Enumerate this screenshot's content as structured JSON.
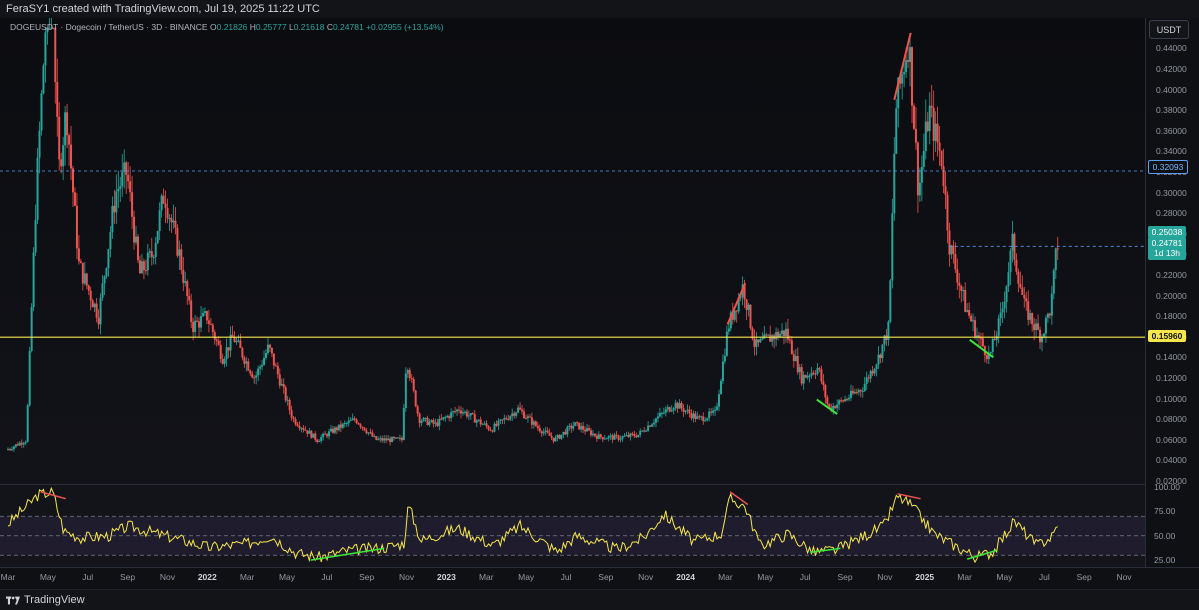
{
  "header": {
    "title": "FeraSY1 created with TradingView.com, Jul 19, 2025 11:22 UTC"
  },
  "legend": {
    "symbol": "DOGEUSDT · Dogecoin / TetherUS · 3D · BINANCE",
    "open_label": "O",
    "open": "0.21826",
    "high_label": "H",
    "high": "0.25777",
    "low_label": "L",
    "low": "0.21618",
    "close_label": "C",
    "close": "0.24781",
    "change": "+0.02955 (+13.54%)"
  },
  "currency_button": "USDT",
  "price_axis": [
    "0.44000",
    "0.42000",
    "0.40000",
    "0.38000",
    "0.36000",
    "0.34000",
    "0.32000",
    "0.30000",
    "0.28000",
    "0.26000",
    "0.24000",
    "0.22000",
    "0.20000",
    "0.18000",
    "0.16000",
    "0.14000",
    "0.12000",
    "0.10000",
    "0.08000",
    "0.06000",
    "0.04000",
    "0.02000"
  ],
  "price_badges": {
    "horizontal_line": "0.32093",
    "support_line": "0.15960",
    "previous": "0.25038",
    "last": "0.24781",
    "countdown": "1d 13h"
  },
  "rsi_axis": [
    "100.00",
    "75.00",
    "50.00",
    "25.00"
  ],
  "time_axis": [
    {
      "label": "Mar",
      "year": false
    },
    {
      "label": "May",
      "year": false
    },
    {
      "label": "Jul",
      "year": false
    },
    {
      "label": "Sep",
      "year": false
    },
    {
      "label": "Nov",
      "year": false
    },
    {
      "label": "2022",
      "year": true
    },
    {
      "label": "Mar",
      "year": false
    },
    {
      "label": "May",
      "year": false
    },
    {
      "label": "Jul",
      "year": false
    },
    {
      "label": "Sep",
      "year": false
    },
    {
      "label": "Nov",
      "year": false
    },
    {
      "label": "2023",
      "year": true
    },
    {
      "label": "Mar",
      "year": false
    },
    {
      "label": "May",
      "year": false
    },
    {
      "label": "Jul",
      "year": false
    },
    {
      "label": "Sep",
      "year": false
    },
    {
      "label": "Nov",
      "year": false
    },
    {
      "label": "2024",
      "year": true
    },
    {
      "label": "Mar",
      "year": false
    },
    {
      "label": "May",
      "year": false
    },
    {
      "label": "Jul",
      "year": false
    },
    {
      "label": "Sep",
      "year": false
    },
    {
      "label": "Nov",
      "year": false
    },
    {
      "label": "2025",
      "year": true
    },
    {
      "label": "Mar",
      "year": false
    },
    {
      "label": "May",
      "year": false
    },
    {
      "label": "Jul",
      "year": false
    },
    {
      "label": "Sep",
      "year": false
    },
    {
      "label": "Nov",
      "year": false
    }
  ],
  "footer": {
    "brand": "TradingView"
  },
  "colors": {
    "up": "#26a69a",
    "down": "#ef5350",
    "support": "#f5e74a",
    "hline": "#5b9cf6",
    "rsi": "#f5e74a",
    "bear_div": "#ef5350",
    "bull_div": "#39e639"
  },
  "icons": {
    "logo": "tradingview-logo-icon"
  },
  "chart_data": {
    "type": "candlestick",
    "symbol": "DOGEUSDT",
    "timeframe": "3D",
    "y_scale": "linear",
    "ylim": [
      0.02,
      0.45
    ],
    "x_range": [
      "2021-03",
      "2025-11"
    ],
    "price_path": [
      [
        "2021-03-01",
        0.05
      ],
      [
        "2021-04-01",
        0.06
      ],
      [
        "2021-04-16",
        0.3
      ],
      [
        "2021-05-08",
        0.55
      ],
      [
        "2021-05-20",
        0.32
      ],
      [
        "2021-06-01",
        0.38
      ],
      [
        "2021-06-20",
        0.23
      ],
      [
        "2021-07-20",
        0.18
      ],
      [
        "2021-08-15",
        0.3
      ],
      [
        "2021-09-01",
        0.32
      ],
      [
        "2021-09-20",
        0.22
      ],
      [
        "2021-10-10",
        0.24
      ],
      [
        "2021-10-28",
        0.3
      ],
      [
        "2021-11-20",
        0.24
      ],
      [
        "2021-12-10",
        0.17
      ],
      [
        "2022-01-01",
        0.18
      ],
      [
        "2022-01-25",
        0.14
      ],
      [
        "2022-02-10",
        0.16
      ],
      [
        "2022-03-15",
        0.12
      ],
      [
        "2022-04-05",
        0.15
      ],
      [
        "2022-05-12",
        0.08
      ],
      [
        "2022-06-18",
        0.06
      ],
      [
        "2022-07-15",
        0.07
      ],
      [
        "2022-08-15",
        0.08
      ],
      [
        "2022-09-15",
        0.06
      ],
      [
        "2022-10-25",
        0.06
      ],
      [
        "2022-11-01",
        0.14
      ],
      [
        "2022-11-20",
        0.08
      ],
      [
        "2022-12-15",
        0.075
      ],
      [
        "2023-01-20",
        0.09
      ],
      [
        "2023-03-10",
        0.07
      ],
      [
        "2023-04-20",
        0.09
      ],
      [
        "2023-05-20",
        0.072
      ],
      [
        "2023-06-15",
        0.06
      ],
      [
        "2023-07-15",
        0.075
      ],
      [
        "2023-08-20",
        0.063
      ],
      [
        "2023-09-20",
        0.062
      ],
      [
        "2023-10-20",
        0.065
      ],
      [
        "2023-11-15",
        0.08
      ],
      [
        "2023-12-15",
        0.095
      ],
      [
        "2024-01-20",
        0.08
      ],
      [
        "2024-02-15",
        0.086
      ],
      [
        "2024-03-05",
        0.17
      ],
      [
        "2024-03-28",
        0.21
      ],
      [
        "2024-04-15",
        0.15
      ],
      [
        "2024-05-10",
        0.16
      ],
      [
        "2024-06-01",
        0.165
      ],
      [
        "2024-06-25",
        0.12
      ],
      [
        "2024-07-20",
        0.13
      ],
      [
        "2024-08-05",
        0.09
      ],
      [
        "2024-09-01",
        0.1
      ],
      [
        "2024-09-25",
        0.11
      ],
      [
        "2024-10-20",
        0.14
      ],
      [
        "2024-11-05",
        0.17
      ],
      [
        "2024-11-15",
        0.38
      ],
      [
        "2024-12-05",
        0.45
      ],
      [
        "2024-12-20",
        0.3
      ],
      [
        "2025-01-05",
        0.38
      ],
      [
        "2025-01-25",
        0.33
      ],
      [
        "2025-02-05",
        0.25
      ],
      [
        "2025-03-01",
        0.19
      ],
      [
        "2025-03-20",
        0.16
      ],
      [
        "2025-04-07",
        0.14
      ],
      [
        "2025-04-25",
        0.18
      ],
      [
        "2025-05-12",
        0.25
      ],
      [
        "2025-05-30",
        0.19
      ],
      [
        "2025-06-15",
        0.17
      ],
      [
        "2025-06-25",
        0.16
      ],
      [
        "2025-07-10",
        0.19
      ],
      [
        "2025-07-19",
        0.25
      ]
    ],
    "horizontal_lines": [
      0.32093,
      0.1596
    ],
    "last_price": 0.24781,
    "annotations": [
      {
        "type": "bearish_trendline",
        "from": [
          "2024-03-01",
          0.172
        ],
        "to": [
          "2024-03-28",
          0.212
        ]
      },
      {
        "type": "bearish_trendline",
        "from": [
          "2024-11-10",
          0.39
        ],
        "to": [
          "2024-12-05",
          0.455
        ]
      },
      {
        "type": "bullish_trendline",
        "from": [
          "2024-07-15",
          0.099
        ],
        "to": [
          "2024-08-15",
          0.085
        ]
      },
      {
        "type": "bullish_trendline",
        "from": [
          "2025-03-05",
          0.157
        ],
        "to": [
          "2025-04-10",
          0.14
        ]
      }
    ],
    "rsi": {
      "ylim": [
        20,
        100
      ],
      "bands": [
        30,
        50,
        70
      ],
      "path": [
        [
          "2021-03-01",
          62
        ],
        [
          "2021-04-16",
          92
        ],
        [
          "2021-05-08",
          95
        ],
        [
          "2021-05-25",
          55
        ],
        [
          "2021-06-20",
          48
        ],
        [
          "2021-08-01",
          50
        ],
        [
          "2021-09-01",
          60
        ],
        [
          "2021-10-15",
          52
        ],
        [
          "2021-11-25",
          45
        ],
        [
          "2022-01-01",
          38
        ],
        [
          "2022-03-01",
          42
        ],
        [
          "2022-04-05",
          50
        ],
        [
          "2022-05-15",
          32
        ],
        [
          "2022-06-18",
          28
        ],
        [
          "2022-08-01",
          35
        ],
        [
          "2022-09-25",
          38
        ],
        [
          "2022-10-25",
          42
        ],
        [
          "2022-11-01",
          82
        ],
        [
          "2022-11-20",
          45
        ],
        [
          "2023-01-15",
          58
        ],
        [
          "2023-03-10",
          40
        ],
        [
          "2023-04-20",
          60
        ],
        [
          "2023-06-15",
          34
        ],
        [
          "2023-07-15",
          50
        ],
        [
          "2023-09-15",
          36
        ],
        [
          "2023-10-25",
          48
        ],
        [
          "2023-11-25",
          72
        ],
        [
          "2024-01-10",
          44
        ],
        [
          "2024-02-20",
          52
        ],
        [
          "2024-03-05",
          88
        ],
        [
          "2024-03-28",
          80
        ],
        [
          "2024-04-20",
          40
        ],
        [
          "2024-06-01",
          52
        ],
        [
          "2024-07-10",
          33
        ],
        [
          "2024-08-15",
          36
        ],
        [
          "2024-09-25",
          50
        ],
        [
          "2024-10-25",
          60
        ],
        [
          "2024-11-15",
          90
        ],
        [
          "2024-12-05",
          82
        ],
        [
          "2025-01-10",
          52
        ],
        [
          "2025-02-10",
          40
        ],
        [
          "2025-03-15",
          28
        ],
        [
          "2025-04-10",
          34
        ],
        [
          "2025-05-12",
          65
        ],
        [
          "2025-06-15",
          40
        ],
        [
          "2025-07-10",
          50
        ],
        [
          "2025-07-19",
          67
        ]
      ],
      "annotations": [
        {
          "type": "bearish_divergence",
          "from": [
            "2021-04-20",
            95
          ],
          "to": [
            "2021-05-28",
            88
          ]
        },
        {
          "type": "bullish_divergence",
          "from": [
            "2022-06-05",
            25
          ],
          "to": [
            "2022-09-25",
            37
          ]
        },
        {
          "type": "bearish_divergence",
          "from": [
            "2024-03-05",
            95
          ],
          "to": [
            "2024-04-01",
            82
          ]
        },
        {
          "type": "bullish_divergence",
          "from": [
            "2024-07-05",
            33
          ],
          "to": [
            "2024-08-20",
            37
          ]
        },
        {
          "type": "bearish_divergence",
          "from": [
            "2024-11-15",
            93
          ],
          "to": [
            "2024-12-20",
            88
          ]
        },
        {
          "type": "bullish_divergence",
          "from": [
            "2025-03-01",
            26
          ],
          "to": [
            "2025-04-15",
            35
          ]
        }
      ]
    }
  }
}
